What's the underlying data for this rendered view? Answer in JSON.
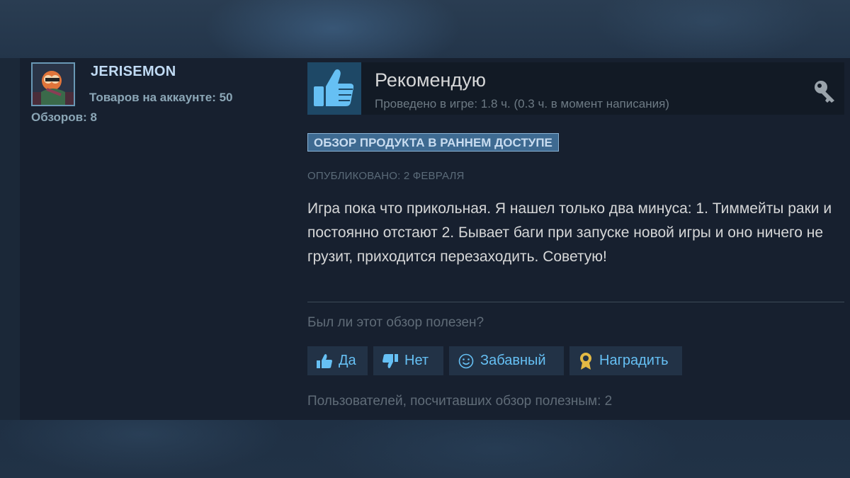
{
  "author": {
    "name": "JERISEMON",
    "items_label": "Товаров на аккаунте: 50",
    "reviews_label": "Обзоров: 8"
  },
  "review": {
    "verdict": "Рекомендую",
    "playtime": "Проведено в игре: 1.8 ч. (0.3 ч. в момент написания)",
    "early_access_badge": "ОБЗОР ПРОДУКТА В РАННЕМ ДОСТУПЕ",
    "posted": "ОПУБЛИКОВАНО: 2 ФЕВРАЛЯ",
    "body": "Игра пока что прикольная. Я нашел только два минуса: 1. Тиммейты раки и постоянно отстают 2. Бывает баги при запуске новой игры и оно ничего не грузит, приходится перезаходить. Советую!"
  },
  "feedback": {
    "question": "Был ли этот обзор полезен?",
    "yes_label": "Да",
    "no_label": "Нет",
    "funny_label": "Забавный",
    "award_label": "Наградить",
    "helpful_count_text": "Пользователей, посчитавших обзор полезным: 2"
  },
  "icons": {
    "thumbs_up": "thumbs-up-icon",
    "thumbs_down": "thumbs-down-icon",
    "smile": "smile-icon",
    "award": "award-icon",
    "key": "key-icon"
  },
  "colors": {
    "accent": "#66c0f4",
    "thumb_box": "#1e4866",
    "badge_bg": "#3e6a91",
    "award_gold": "#e3b944"
  }
}
